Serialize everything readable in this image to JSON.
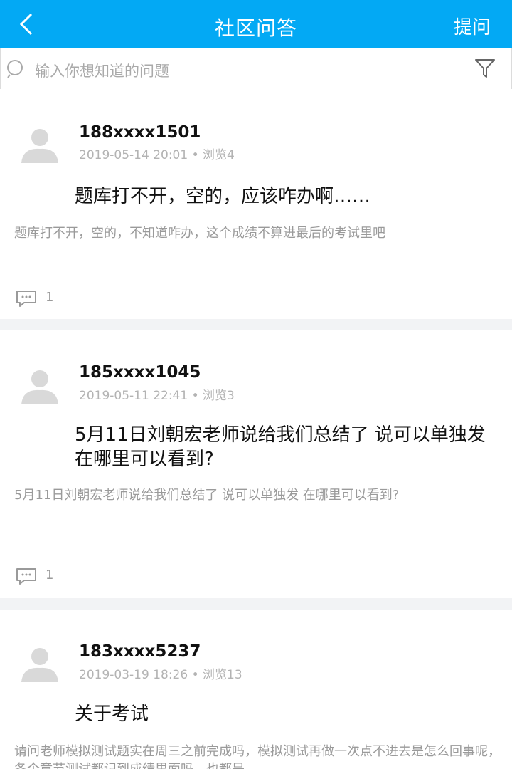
{
  "header": {
    "title": "社区问答",
    "ask_label": "提问"
  },
  "search": {
    "placeholder": "输入你想知道的问题"
  },
  "posts": [
    {
      "user": "188xxxx1501",
      "date": "2019-05-14 20:01",
      "views": "浏览4",
      "title": "题库打不开，空的，应该咋办啊……",
      "body": "题库打不开，空的，不知道咋办，这个成绩不算进最后的考试里吧",
      "comments": "1"
    },
    {
      "user": "185xxxx1045",
      "date": "2019-05-11 22:41",
      "views": "浏览3",
      "title": "5月11日刘朝宏老师说给我们总结了 说可以单独发 在哪里可以看到?",
      "body": "5月11日刘朝宏老师说给我们总结了 说可以单独发 在哪里可以看到?",
      "comments": "1"
    },
    {
      "user": "183xxxx5237",
      "date": "2019-03-19 18:26",
      "views": "浏览13",
      "title": "关于考试",
      "body": "请问老师模拟测试题实在周三之前完成吗，模拟测试再做一次点不进去是怎么回事呢，各个章节测试都记到成绩里面吗，也都是",
      "comments": ""
    }
  ],
  "colors": {
    "accent": "#03a9f4",
    "divider": "#f2f3f5"
  },
  "icons": {
    "back": "back-arrow-icon",
    "search": "search-icon",
    "filter": "filter-icon",
    "comment": "comment-icon",
    "avatar": "avatar-icon"
  }
}
